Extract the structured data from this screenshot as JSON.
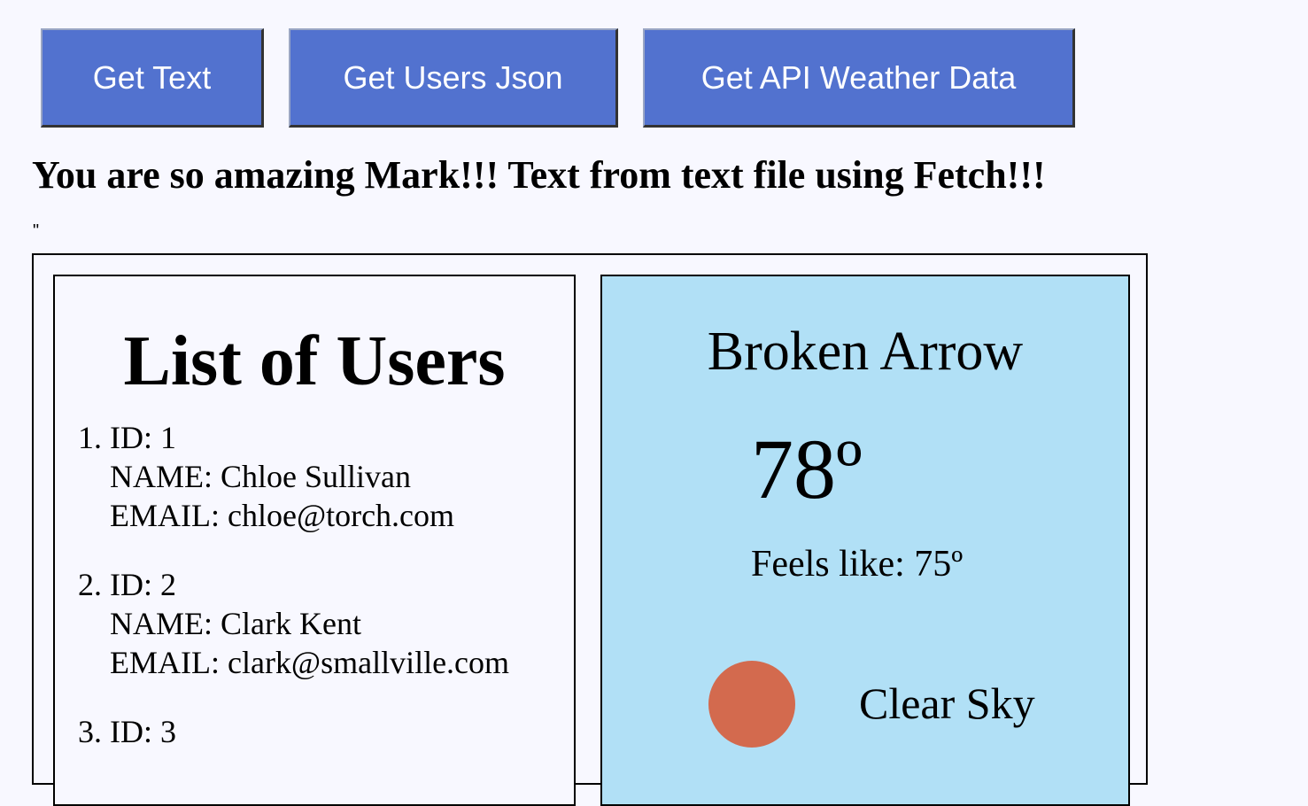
{
  "toolbar": {
    "get_text_label": "Get Text",
    "get_users_label": "Get Users Json",
    "get_weather_label": "Get API Weather Data"
  },
  "message": "You are so amazing Mark!!! Text from text file using Fetch!!!",
  "stray_quote": "\"",
  "users": {
    "title": "List of Users",
    "items": [
      {
        "id": "ID: 1",
        "name": "NAME: Chloe Sullivan",
        "email": "EMAIL: chloe@torch.com"
      },
      {
        "id": "ID: 2",
        "name": "NAME: Clark Kent",
        "email": "EMAIL: clark@smallville.com"
      },
      {
        "id": "ID: 3"
      }
    ]
  },
  "weather": {
    "city": "Broken Arrow",
    "temperature": "78º",
    "feels_like": "Feels like: 75º",
    "condition": "Clear Sky",
    "icon": "sun-icon"
  },
  "colors": {
    "button_bg": "#5272cf",
    "weather_card_bg": "#b1e0f6",
    "sun": "#d36a4e",
    "page_bg": "#f8f8ff"
  }
}
